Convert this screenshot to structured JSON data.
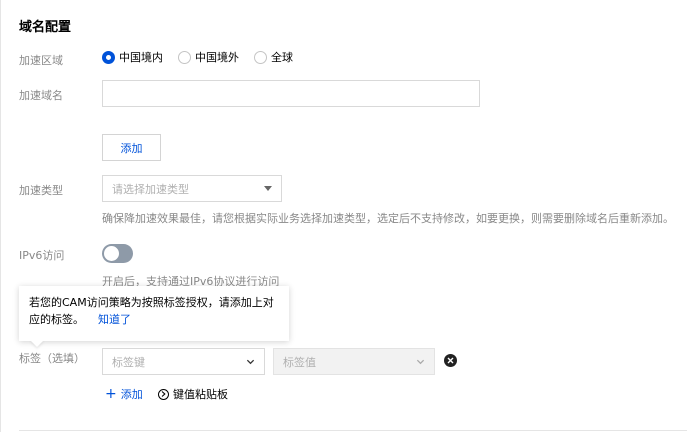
{
  "section_title": "域名配置",
  "accel_region": {
    "label": "加速区域",
    "options": [
      {
        "label": "中国境内",
        "checked": true
      },
      {
        "label": "中国境外",
        "checked": false
      },
      {
        "label": "全球",
        "checked": false
      }
    ]
  },
  "accel_domain": {
    "label": "加速域名",
    "value": ""
  },
  "add_domain_button": "添加",
  "accel_type": {
    "label": "加速类型",
    "placeholder": "请选择加速类型",
    "hint": "确保降加速效果最佳，请您根据实际业务选择加速类型，选定后不支持修改，如要更换，则需要删除域名后重新添加。"
  },
  "ipv6": {
    "label": "IPv6访问",
    "enabled": false,
    "hint": "开启后，支持通过IPv6协议进行访问"
  },
  "tooltip": {
    "line1": "若您的CAM访问策略为按照标签授权，请添加上对",
    "line2": "应的标签。",
    "link": "知道了"
  },
  "tags": {
    "label": "标签（选填）",
    "key_placeholder": "标签键",
    "value_placeholder": "标签值",
    "add_label": "添加",
    "paste_label": "键值粘贴板"
  },
  "colors": {
    "primary": "#0052d9",
    "label_gray": "#888888",
    "toggle_off": "#8e9aa8"
  }
}
